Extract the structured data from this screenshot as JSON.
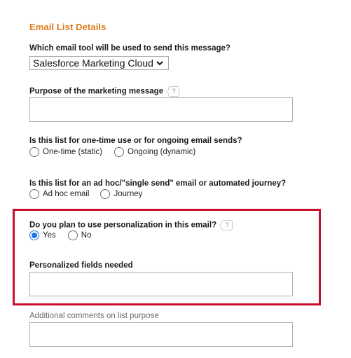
{
  "section": {
    "title": "Email List Details",
    "title_color": "#e07b1a"
  },
  "email_tool": {
    "label": "Which email tool will be used to send this message?",
    "selected": "Salesforce Marketing Cloud",
    "icon": "chevron-down-icon"
  },
  "purpose": {
    "label": "Purpose of the marketing message",
    "help": "?",
    "value": ""
  },
  "list_use": {
    "label": "Is this list for one-time use or for ongoing email sends?",
    "options": [
      {
        "label": "One-time (static)",
        "checked": false
      },
      {
        "label": "Ongoing (dynamic)",
        "checked": false
      }
    ]
  },
  "send_type": {
    "label": "Is this list for an ad hoc/\"single send\" email or automated journey?",
    "options": [
      {
        "label": "Ad hoc email",
        "checked": false
      },
      {
        "label": "Journey",
        "checked": false
      }
    ]
  },
  "personalization": {
    "label": "Do you plan to use personalization in this email?",
    "help": "?",
    "options": [
      {
        "label": "Yes",
        "checked": true
      },
      {
        "label": "No",
        "checked": false
      }
    ],
    "highlight_color": "#c8102e"
  },
  "personalized_fields": {
    "label": "Personalized fields needed",
    "value": ""
  },
  "additional_comments": {
    "label": "Additional comments on list purpose",
    "value": ""
  }
}
